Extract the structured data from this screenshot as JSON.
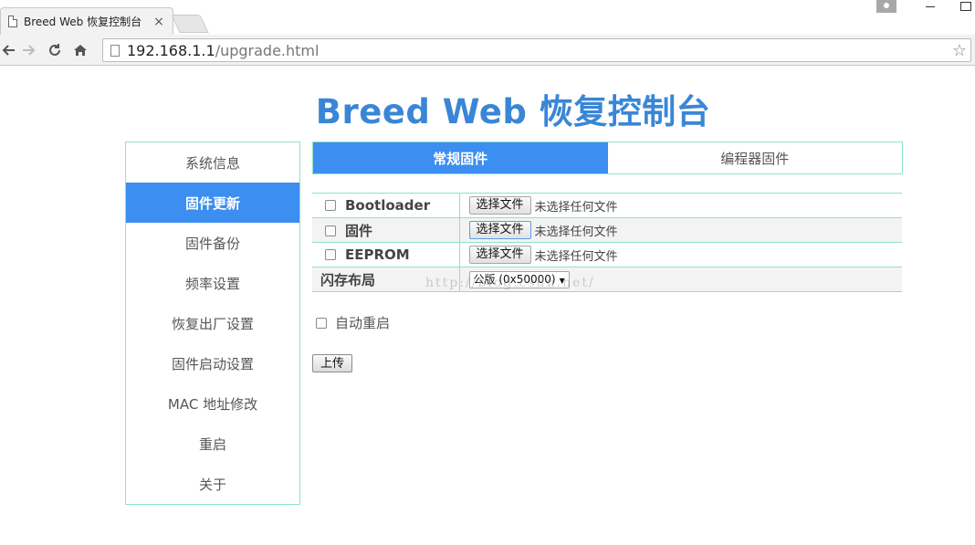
{
  "browser": {
    "tab_title": "Breed Web 恢复控制台",
    "tab_close": "×",
    "url_host": "192.168.1.1",
    "url_path": "/upgrade.html"
  },
  "icons": {
    "back": "back-arrow-icon",
    "forward": "forward-arrow-icon",
    "reload": "reload-icon",
    "home": "home-icon",
    "star": "star-icon",
    "page": "page-icon",
    "user": "user-icon"
  },
  "colors": {
    "accent": "#3c8ef0",
    "title": "#3a86d6",
    "border": "#8fe2c9"
  },
  "page": {
    "title": "Breed Web 恢复控制台"
  },
  "sidebar": {
    "items": [
      {
        "label": "系统信息"
      },
      {
        "label": "固件更新"
      },
      {
        "label": "固件备份"
      },
      {
        "label": "频率设置"
      },
      {
        "label": "恢复出厂设置"
      },
      {
        "label": "固件启动设置"
      },
      {
        "label": "MAC 地址修改"
      },
      {
        "label": "重启"
      },
      {
        "label": "关于"
      }
    ],
    "active_index": 1
  },
  "main": {
    "tabs": [
      {
        "label": "常规固件"
      },
      {
        "label": "编程器固件"
      }
    ],
    "rows": [
      {
        "label": "Bootloader",
        "button": "选择文件",
        "status": "未选择任何文件"
      },
      {
        "label": "固件",
        "button": "选择文件",
        "status": "未选择任何文件"
      },
      {
        "label": "EEPROM",
        "button": "选择文件",
        "status": "未选择任何文件"
      }
    ],
    "layout_row": {
      "label": "闪存布局",
      "selected": "公版 (0x50000)"
    },
    "watermark": "http://blog.csdn.net/",
    "auto_reboot_label": "自动重启",
    "upload_label": "上传"
  }
}
